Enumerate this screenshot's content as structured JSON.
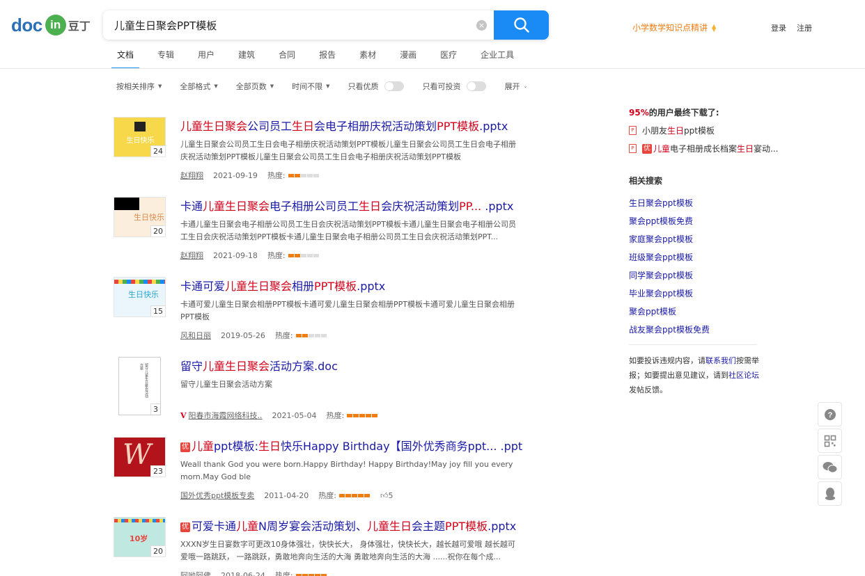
{
  "logo": {
    "part1": "doc",
    "part2": "in",
    "part3": "豆丁"
  },
  "search": {
    "value": "儿童生日聚会PPT模板",
    "placeholder": "",
    "clear_symbol": "×"
  },
  "header": {
    "promo": "小学数学知识点精讲",
    "login": "登录",
    "register": "注册"
  },
  "tabs": [
    "文档",
    "专辑",
    "用户",
    "建筑",
    "合同",
    "报告",
    "素材",
    "漫画",
    "医疗",
    "企业工具"
  ],
  "active_tab": "文档",
  "filters": {
    "sort": "按相关排序",
    "format": "全部格式",
    "pages": "全部页数",
    "time": "时间不限",
    "quality": "只看优质",
    "investable": "只看可投资",
    "expand": "展开"
  },
  "heat_label": "热度:",
  "results": [
    {
      "title": [
        "儿童生日聚会",
        "公司员工",
        "生日",
        "会电子相册庆祝活动策划",
        "PPT模板",
        ".pptx"
      ],
      "desc": "儿童生日聚会公司员工生日会电子相册庆祝活动策划PPT模板儿童生日聚会公司员工生日会电子相册庆祝活动策划PPT模板儿童生日聚会公司员工生日会电子相册庆祝活动策划PPT模板",
      "pages": "24",
      "author": "赵翔翔",
      "date": "2021-09-19",
      "heat": 2,
      "heat_total": 5,
      "thumb_text": "生日快乐"
    },
    {
      "title": [
        "卡通",
        "儿童生日聚会",
        "电子相册公司员工",
        "生日",
        "会庆祝活动策划",
        "PP...",
        " .pptx"
      ],
      "desc": "卡通儿童生日聚会电子相册公司员工生日会庆祝活动策划PPT模板卡通儿童生日聚会电子相册公司员工生日会庆祝活动策划PPT模板卡通儿童生日聚会电子相册公司员工生日会庆祝活动策划PPT...",
      "pages": "20",
      "author": "赵翔翔",
      "date": "2021-09-18",
      "heat": 2,
      "heat_total": 5,
      "thumb_text": "生日快乐"
    },
    {
      "title": [
        "卡通可爱",
        "儿童生日聚会",
        "相册",
        "PPT模板",
        ".pptx"
      ],
      "desc": "卡通可爱儿童生日聚会相册PPT模板卡通可爱儿童生日聚会相册PPT模板卡通可爱儿童生日聚会相册PPT模板",
      "pages": "15",
      "author": "风和日丽",
      "date": "2019-05-26",
      "heat": 2,
      "heat_total": 5,
      "thumb_text": "生日快乐"
    },
    {
      "title": [
        "留守",
        "儿童生日聚会",
        "活动方案",
        ".doc"
      ],
      "desc": "留守儿童生日聚会活动方案",
      "pages": "3",
      "author": "阳春市海霞网络科技..",
      "author_badge": "V",
      "date": "2021-05-04",
      "heat": 5,
      "heat_total": 5,
      "thumb_text": "留守儿童生日聚会活动方案"
    },
    {
      "badge": "优",
      "title": [
        "儿童",
        "ppt模板:",
        "生日",
        "快乐Happy Birthday【国外优秀商务ppt...",
        " .ppt"
      ],
      "desc": "Weall thank God you were born.Happy Birthday! Happy Birthday!May joy fill you every morn.May God ble",
      "pages": "23",
      "author": "国外优秀ppt模板专卖",
      "date": "2011-04-20",
      "heat": 5,
      "heat_total": 5,
      "likes": "5",
      "thumb_text": "W"
    },
    {
      "badge": "优",
      "title": [
        "可爱卡通",
        "儿童",
        "N周岁宴会活动策划、",
        "儿童生日",
        "会主题",
        "PPT模板",
        ".pptx"
      ],
      "desc": "XXXN岁生日宴数字可更改10身体强壮，快快长大， 身体强壮，快快长大，越长越可爱哦 越长越可爱哦一路跳跃， 一路跳跃，勇敢地奔向生活的大海 勇敢地奔向生活的大海 ......祝你在每个成...",
      "pages": "20",
      "author": "阿呦阿佛",
      "date": "2018-06-24",
      "heat": 5,
      "heat_total": 5,
      "thumb_text": "10岁"
    }
  ],
  "sidebar": {
    "download_pct": "95%",
    "download_text": "的用户最终下载了:",
    "downloads": [
      {
        "pre": "小朋友",
        "hl": "生日",
        "post": "ppt模板",
        "badge": ""
      },
      {
        "pre": "",
        "hl": "儿童",
        "mid": "电子相册成长档案",
        "hl2": "生日",
        "post": "宴动...",
        "badge": "优"
      }
    ],
    "related_title": "相关搜索",
    "related": [
      "生日聚会ppt模板",
      "聚会ppt模板免费",
      "家庭聚会ppt模板",
      "班级聚会ppt模板",
      "同学聚会ppt模板",
      "毕业聚会ppt模板",
      "聚会ppt模板",
      "战友聚会ppt模板免费"
    ],
    "report": {
      "t1": "如要投诉违规内容，请",
      "l1": "联系我们",
      "t2": "按需举报；如要提出意见建议，请到",
      "l2": "社区论坛",
      "t3": "发帖反馈。"
    }
  },
  "float_tools": [
    "help-icon",
    "qrcode-icon",
    "wechat-icon",
    "qq-icon"
  ]
}
